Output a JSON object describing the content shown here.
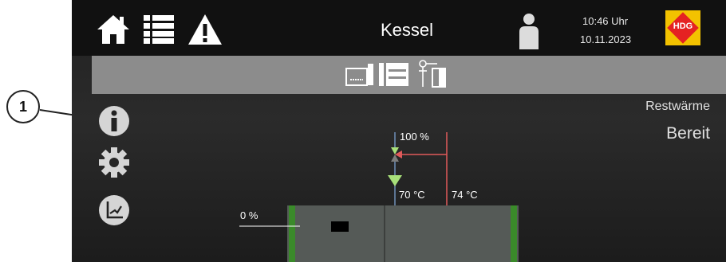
{
  "callout": {
    "number": "1"
  },
  "header": {
    "title": "Kessel",
    "time": "10:46 Uhr",
    "date": "10.11.2023",
    "logo_text": "HDG"
  },
  "status": {
    "mode": "Restwärme",
    "state": "Bereit"
  },
  "diagram": {
    "valve_percent": "100 %",
    "return_temp": "70 °C",
    "flow_temp": "74 °C",
    "boiler_percent": "0 %"
  },
  "colors": {
    "background": "#232323",
    "gray_bar": "#8c8c8c",
    "flow_line": "#e05a5a",
    "return_line": "#6f8fb8",
    "valve_green": "#a8e07a",
    "boiler_body": "#555a57",
    "boiler_edge": "#3a8a2a",
    "logo_yellow": "#f3c200",
    "logo_red": "#e52222"
  },
  "icons": {
    "nav": [
      "home-icon",
      "list-icon",
      "warning-icon"
    ],
    "user": "person-icon",
    "side": [
      "info-icon",
      "gear-icon",
      "chart-axes-icon"
    ],
    "components": [
      "buffer-tank-icon",
      "boiler-icon",
      "pump-valve-icon"
    ]
  }
}
